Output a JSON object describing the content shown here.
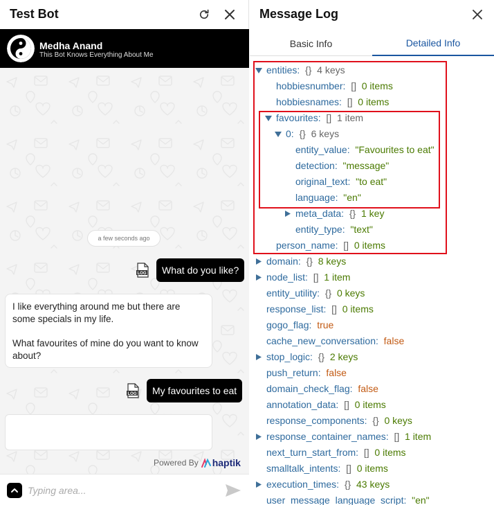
{
  "bot": {
    "title": "Test Bot",
    "profile": {
      "name": "Medha Anand",
      "subtitle": "This Bot Knows Everything About Me"
    },
    "timestamp": "a few seconds ago",
    "messages": {
      "user1": "What do you like?",
      "bot_line1": "I like everything around me but there are some specials in my life.",
      "bot_line2": "What favourites of mine do you want to know about?",
      "user2": "My favourites to eat"
    },
    "log_label": "LOG",
    "powered_by": "Powered By",
    "brand": "haptik",
    "input_placeholder": "Typing area..."
  },
  "log": {
    "title": "Message Log",
    "tabs": {
      "basic": "Basic Info",
      "detailed": "Detailed Info"
    },
    "tree": [
      {
        "arrow": "down",
        "indent": 0,
        "key": "entities:",
        "type": "{}",
        "count": "4 keys",
        "dim": true
      },
      {
        "arrow": "",
        "indent": 1,
        "key": "hobbiesnumber:",
        "type": "[]",
        "count": "0 items"
      },
      {
        "arrow": "",
        "indent": 1,
        "key": "hobbiesnames:",
        "type": "[]",
        "count": "0 items"
      },
      {
        "arrow": "down",
        "indent": 1,
        "key": "favourites:",
        "type": "[]",
        "count": "1 item",
        "dim": true
      },
      {
        "arrow": "down",
        "indent": 2,
        "key": "0:",
        "type": "{}",
        "count": "6 keys",
        "dim": true
      },
      {
        "arrow": "",
        "indent": 3,
        "key": "entity_value:",
        "str": "\"Favourites to eat\""
      },
      {
        "arrow": "",
        "indent": 3,
        "key": "detection:",
        "str": "\"message\""
      },
      {
        "arrow": "",
        "indent": 3,
        "key": "original_text:",
        "str": "\"to eat\""
      },
      {
        "arrow": "",
        "indent": 3,
        "key": "language:",
        "str": "\"en\""
      },
      {
        "arrow": "right",
        "indent": 3,
        "key": "meta_data:",
        "type": "{}",
        "count": "1 key"
      },
      {
        "arrow": "",
        "indent": 3,
        "key": "entity_type:",
        "str": "\"text\""
      },
      {
        "arrow": "",
        "indent": 1,
        "key": "person_name:",
        "type": "[]",
        "count": "0 items"
      },
      {
        "arrow": "right",
        "indent": 0,
        "key": "domain:",
        "type": "{}",
        "count": "8 keys"
      },
      {
        "arrow": "right",
        "indent": 0,
        "key": "node_list:",
        "type": "[]",
        "count": "1 item"
      },
      {
        "arrow": "",
        "indent": 0,
        "key": "entity_utility:",
        "type": "{}",
        "count": "0 keys"
      },
      {
        "arrow": "",
        "indent": 0,
        "key": "response_list:",
        "type": "[]",
        "count": "0 items"
      },
      {
        "arrow": "",
        "indent": 0,
        "key": "gogo_flag:",
        "bool": "true"
      },
      {
        "arrow": "",
        "indent": 0,
        "key": "cache_new_conversation:",
        "bool": "false"
      },
      {
        "arrow": "right",
        "indent": 0,
        "key": "stop_logic:",
        "type": "{}",
        "count": "2 keys"
      },
      {
        "arrow": "",
        "indent": 0,
        "key": "push_return:",
        "bool": "false"
      },
      {
        "arrow": "",
        "indent": 0,
        "key": "domain_check_flag:",
        "bool": "false"
      },
      {
        "arrow": "",
        "indent": 0,
        "key": "annotation_data:",
        "type": "[]",
        "count": "0 items"
      },
      {
        "arrow": "",
        "indent": 0,
        "key": "response_components:",
        "type": "{}",
        "count": "0 keys"
      },
      {
        "arrow": "right",
        "indent": 0,
        "key": "response_container_names:",
        "type": "[]",
        "count": "1 item"
      },
      {
        "arrow": "",
        "indent": 0,
        "key": "next_turn_start_from:",
        "type": "[]",
        "count": "0 items"
      },
      {
        "arrow": "",
        "indent": 0,
        "key": "smalltalk_intents:",
        "type": "[]",
        "count": "0 items"
      },
      {
        "arrow": "right",
        "indent": 0,
        "key": "execution_times:",
        "type": "{}",
        "count": "43 keys"
      },
      {
        "arrow": "",
        "indent": 0,
        "key": "user_message_language_script:",
        "str": "\"en\""
      }
    ]
  },
  "colors": {
    "accent": "#1a56a0",
    "highlight": "#e0101b",
    "key": "#2e6a9e",
    "string": "#4a7a00",
    "bool": "#c25a13"
  }
}
